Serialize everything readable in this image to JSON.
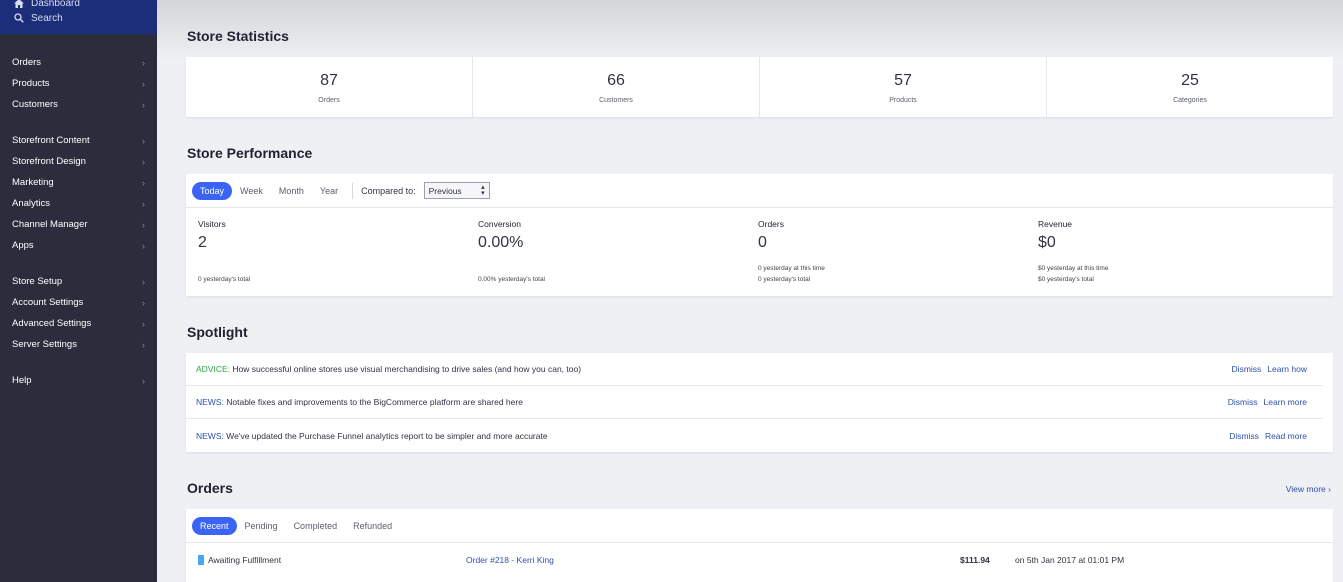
{
  "sidebar": {
    "top": [
      {
        "label": "Dashboard",
        "icon": "home-icon"
      },
      {
        "label": "Search",
        "icon": "search-icon"
      }
    ],
    "groups": [
      [
        {
          "label": "Orders"
        },
        {
          "label": "Products"
        },
        {
          "label": "Customers"
        }
      ],
      [
        {
          "label": "Storefront Content"
        },
        {
          "label": "Storefront Design"
        },
        {
          "label": "Marketing"
        },
        {
          "label": "Analytics"
        },
        {
          "label": "Channel Manager"
        },
        {
          "label": "Apps"
        }
      ],
      [
        {
          "label": "Store Setup"
        },
        {
          "label": "Account Settings"
        },
        {
          "label": "Advanced Settings"
        },
        {
          "label": "Server Settings"
        }
      ],
      [
        {
          "label": "Help"
        }
      ]
    ]
  },
  "stats": {
    "title": "Store Statistics",
    "items": [
      {
        "value": "87",
        "label": "Orders"
      },
      {
        "value": "66",
        "label": "Customers"
      },
      {
        "value": "57",
        "label": "Products"
      },
      {
        "value": "25",
        "label": "Categories"
      }
    ]
  },
  "performance": {
    "title": "Store Performance",
    "periods": [
      "Today",
      "Week",
      "Month",
      "Year"
    ],
    "compared_label": "Compared to:",
    "compared_value": "Previous",
    "metrics": [
      {
        "label": "Visitors",
        "value": "2",
        "subs": [
          "0 yesterday's total"
        ]
      },
      {
        "label": "Conversion",
        "value": "0.00%",
        "subs": [
          "0.00% yesterday's total"
        ]
      },
      {
        "label": "Orders",
        "value": "0",
        "subs": [
          "0 yesterday at this time",
          "0 yesterday's total"
        ]
      },
      {
        "label": "Revenue",
        "value": "$0",
        "subs": [
          "$0 yesterday at this time",
          "$0 yesterday's total"
        ]
      }
    ]
  },
  "spotlight": {
    "title": "Spotlight",
    "items": [
      {
        "tag": "ADVICE:",
        "text": " How successful online stores use visual merchandising to drive sales (and how you can, too)",
        "dismiss": "Dismiss",
        "action": "Learn how"
      },
      {
        "tag": "NEWS:",
        "text": " Notable fixes and improvements to the BigCommerce platform are shared here",
        "dismiss": "Dismiss",
        "action": "Learn more"
      },
      {
        "tag": "NEWS:",
        "text": " We've updated the Purchase Funnel analytics report to be simpler and more accurate",
        "dismiss": "Dismiss",
        "action": "Read more"
      }
    ]
  },
  "orders": {
    "title": "Orders",
    "view_more": "View more",
    "tabs": [
      "Recent",
      "Pending",
      "Completed",
      "Refunded"
    ],
    "rows": [
      {
        "status": "Awaiting Fulfillment",
        "order": "Order #218 - Kerri King",
        "total": "$111.94",
        "date": "on 5th Jan 2017 at 01:01 PM"
      }
    ]
  },
  "colors": {
    "accent": "#3c64f4",
    "sidebar": "#2b2d3c",
    "link": "#2e4fb0",
    "advice": "#27a745"
  }
}
